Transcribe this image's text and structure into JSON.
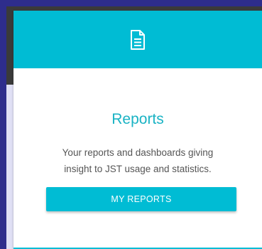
{
  "card": {
    "icon": "document-icon",
    "title": "Reports",
    "description_line1": "Your reports and dashboards giving",
    "description_line2": "insight to JST usage and statistics.",
    "button_label": "MY REPORTS"
  },
  "colors": {
    "accent": "#00bcd4",
    "title": "#1ab3c4",
    "text": "#555555",
    "page_border": "#2e2d8c"
  }
}
